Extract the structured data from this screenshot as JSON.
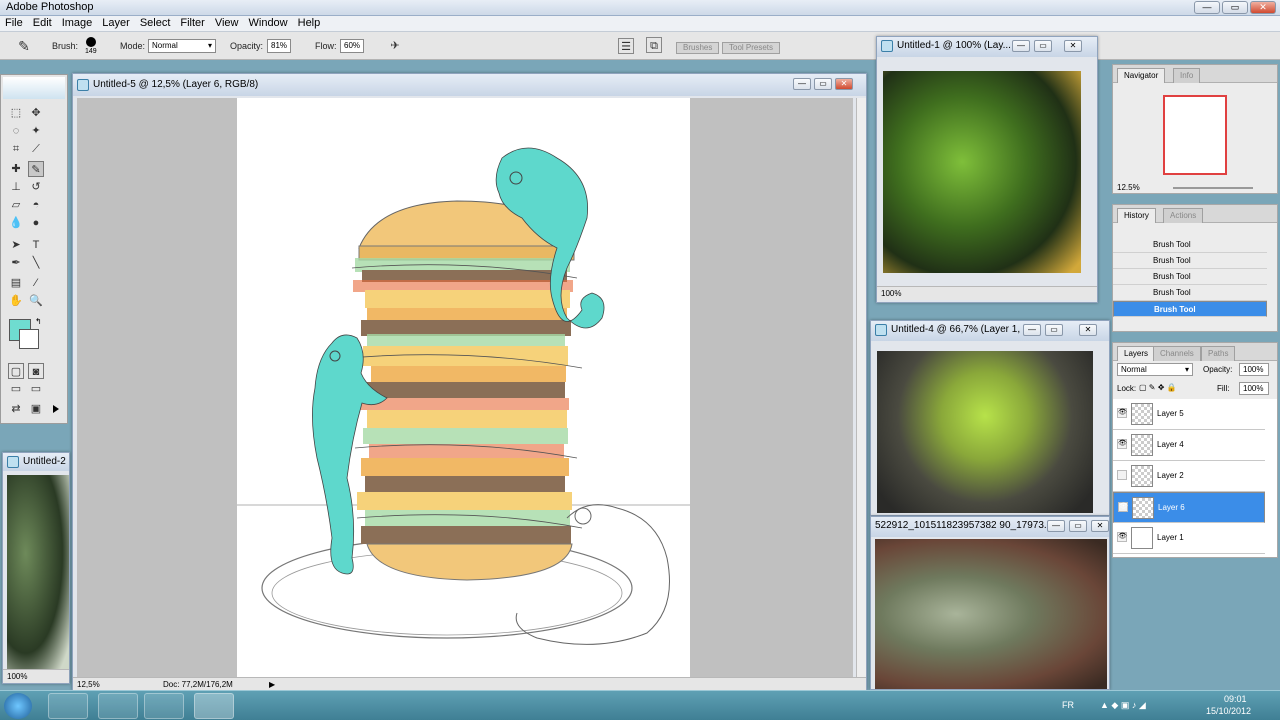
{
  "app": {
    "title": "Adobe Photoshop"
  },
  "menu": [
    "File",
    "Edit",
    "Image",
    "Layer",
    "Select",
    "Filter",
    "View",
    "Window",
    "Help"
  ],
  "options": {
    "brush_label": "Brush:",
    "brush_size": "149",
    "mode_label": "Mode:",
    "mode_value": "Normal",
    "opacity_label": "Opacity:",
    "opacity_value": "81%",
    "flow_label": "Flow:",
    "flow_value": "60%",
    "tabs": [
      "Brushes",
      "Tool Presets"
    ]
  },
  "windows": {
    "main": {
      "title": "Untitled-5 @ 12,5% (Layer 6, RGB/8)",
      "zoom": "12,5%",
      "doc": "Doc: 77,2M/176,2M"
    },
    "ref1": {
      "title": "Untitled-1 @ 100% (Lay...",
      "zoom": "100%"
    },
    "ref2": {
      "title": "Untitled-4 @ 66,7% (Layer 1, ..."
    },
    "ref3": {
      "title": "522912_101511823957382 90_17973..."
    },
    "left": {
      "title": "Untitled-2",
      "zoom": "100%"
    }
  },
  "navigator": {
    "tabs": [
      "Navigator",
      "Info"
    ],
    "zoom": "12.5%"
  },
  "history": {
    "tabs": [
      "History",
      "Actions"
    ],
    "items": [
      "Brush Tool",
      "Brush Tool",
      "Brush Tool",
      "Brush Tool",
      "Brush Tool"
    ]
  },
  "layers": {
    "tabs": [
      "Layers",
      "Channels",
      "Paths"
    ],
    "blend": "Normal",
    "opacity_label": "Opacity:",
    "opacity": "100%",
    "lock_label": "Lock:",
    "fill_label": "Fill:",
    "fill": "100%",
    "items": [
      "Layer 5",
      "Layer 4",
      "Layer 2",
      "Layer 6",
      "Layer 1"
    ]
  },
  "tray": {
    "lang": "FR",
    "time": "09:01",
    "date": "15/10/2012"
  },
  "colors": {
    "foreground": "#6fdcd0",
    "selection": "#3b8de8",
    "chameleon": "#5ed8cc"
  }
}
